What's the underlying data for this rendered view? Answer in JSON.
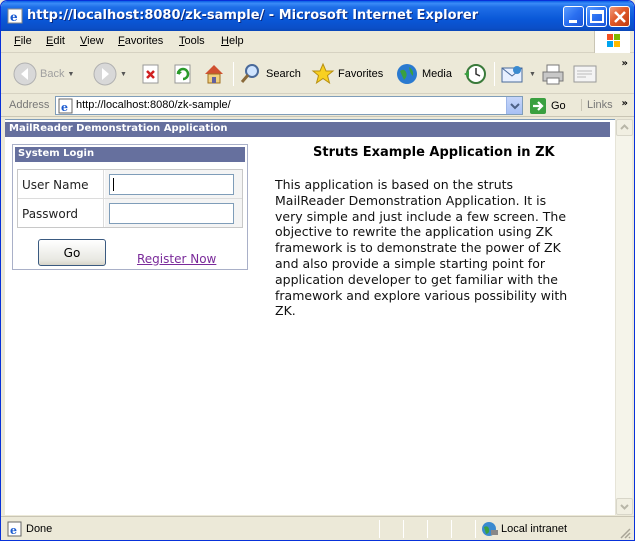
{
  "window": {
    "title": "http://localhost:8080/zk-sample/ - Microsoft Internet Explorer"
  },
  "menu": [
    "File",
    "Edit",
    "View",
    "Favorites",
    "Tools",
    "Help"
  ],
  "toolbar": {
    "back": "Back",
    "search": "Search",
    "favorites": "Favorites",
    "media": "Media"
  },
  "address": {
    "label": "Address",
    "url": "http://localhost:8080/zk-sample/",
    "go": "Go",
    "links": "Links"
  },
  "page": {
    "header": "MailReader Demonstration Application",
    "login": {
      "title": "System Login",
      "username_label": "User Name",
      "username_value": "",
      "password_label": "Password",
      "password_value": "",
      "go_label": "Go",
      "register_label": "Register Now"
    },
    "main": {
      "title": "Struts Example Application in ZK",
      "description": "This application is based on the struts MailReader Demonstration Application. It is very simple and just include a few screen. The objective to rewrite the application using ZK framework is to demonstrate the power of ZK and also provide a simple starting point for application developer to get familiar with the framework and explore various possibility with ZK."
    }
  },
  "status": {
    "text": "Done",
    "zone": "Local intranet"
  },
  "colors": {
    "header_bg": "#66709e",
    "titlebar": "#0a58d8",
    "link_visited": "#7a2a9a"
  }
}
